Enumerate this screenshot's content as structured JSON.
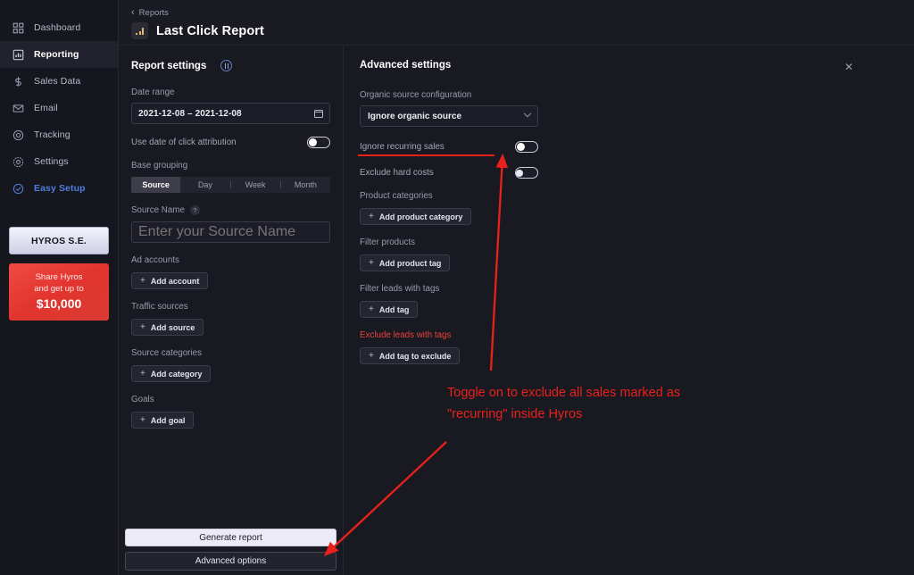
{
  "sidebar": {
    "items": [
      {
        "label": "Dashboard",
        "icon": "grid-icon",
        "active": false
      },
      {
        "label": "Reporting",
        "icon": "bar-chart-icon",
        "active": true
      },
      {
        "label": "Sales Data",
        "icon": "dollar-icon",
        "active": false
      },
      {
        "label": "Email",
        "icon": "envelope-icon",
        "active": false
      },
      {
        "label": "Tracking",
        "icon": "target-icon",
        "active": false
      },
      {
        "label": "Settings",
        "icon": "gear-icon",
        "active": false
      },
      {
        "label": "Easy Setup",
        "icon": "check-circle-icon",
        "active": false
      }
    ],
    "se_button": "HYROS S.E.",
    "promo": {
      "line1": "Share Hyros",
      "line2": "and get up to",
      "amount": "$10,000"
    }
  },
  "header": {
    "breadcrumb": "Reports",
    "title": "Last Click Report",
    "icon": "bar-chart-icon"
  },
  "report_settings": {
    "title": "Report settings",
    "info_icon": "info-columns-icon",
    "date_range": {
      "label": "Date range",
      "value": "2021-12-08 – 2021-12-08",
      "icon": "calendar-icon"
    },
    "click_attribution": {
      "label": "Use date of click attribution",
      "state": "off"
    },
    "base_grouping": {
      "label": "Base grouping",
      "options": [
        "Source",
        "Day",
        "Week",
        "Month"
      ],
      "selected": "Source"
    },
    "source_name": {
      "label": "Source Name",
      "help_icon": "question-icon",
      "placeholder": "Enter your Source Name",
      "value": ""
    },
    "groups": [
      {
        "label": "Ad accounts",
        "button": "Add account"
      },
      {
        "label": "Traffic sources",
        "button": "Add source"
      },
      {
        "label": "Source categories",
        "button": "Add category"
      },
      {
        "label": "Goals",
        "button": "Add goal"
      }
    ],
    "generate_button": "Generate report",
    "advanced_button": "Advanced options"
  },
  "advanced_settings": {
    "title": "Advanced settings",
    "close_icon": "close-icon",
    "organic_source": {
      "label": "Organic source configuration",
      "selected": "Ignore organic source"
    },
    "toggles": [
      {
        "label": "Ignore recurring sales",
        "state": "off",
        "highlighted": true
      },
      {
        "label": "Exclude hard costs",
        "state": "off",
        "highlighted": false
      }
    ],
    "groups": [
      {
        "label": "Product categories",
        "button": "Add product category",
        "red": false
      },
      {
        "label": "Filter products",
        "button": "Add product tag",
        "red": false
      },
      {
        "label": "Filter leads with tags",
        "button": "Add tag",
        "red": false
      },
      {
        "label": "Exclude leads with tags",
        "button": "Add tag to exclude",
        "red": true
      }
    ]
  },
  "annotation": {
    "line1": "Toggle on to exclude all sales marked as",
    "line2": "\"recurring\" inside Hyros",
    "color": "#e8221a"
  }
}
